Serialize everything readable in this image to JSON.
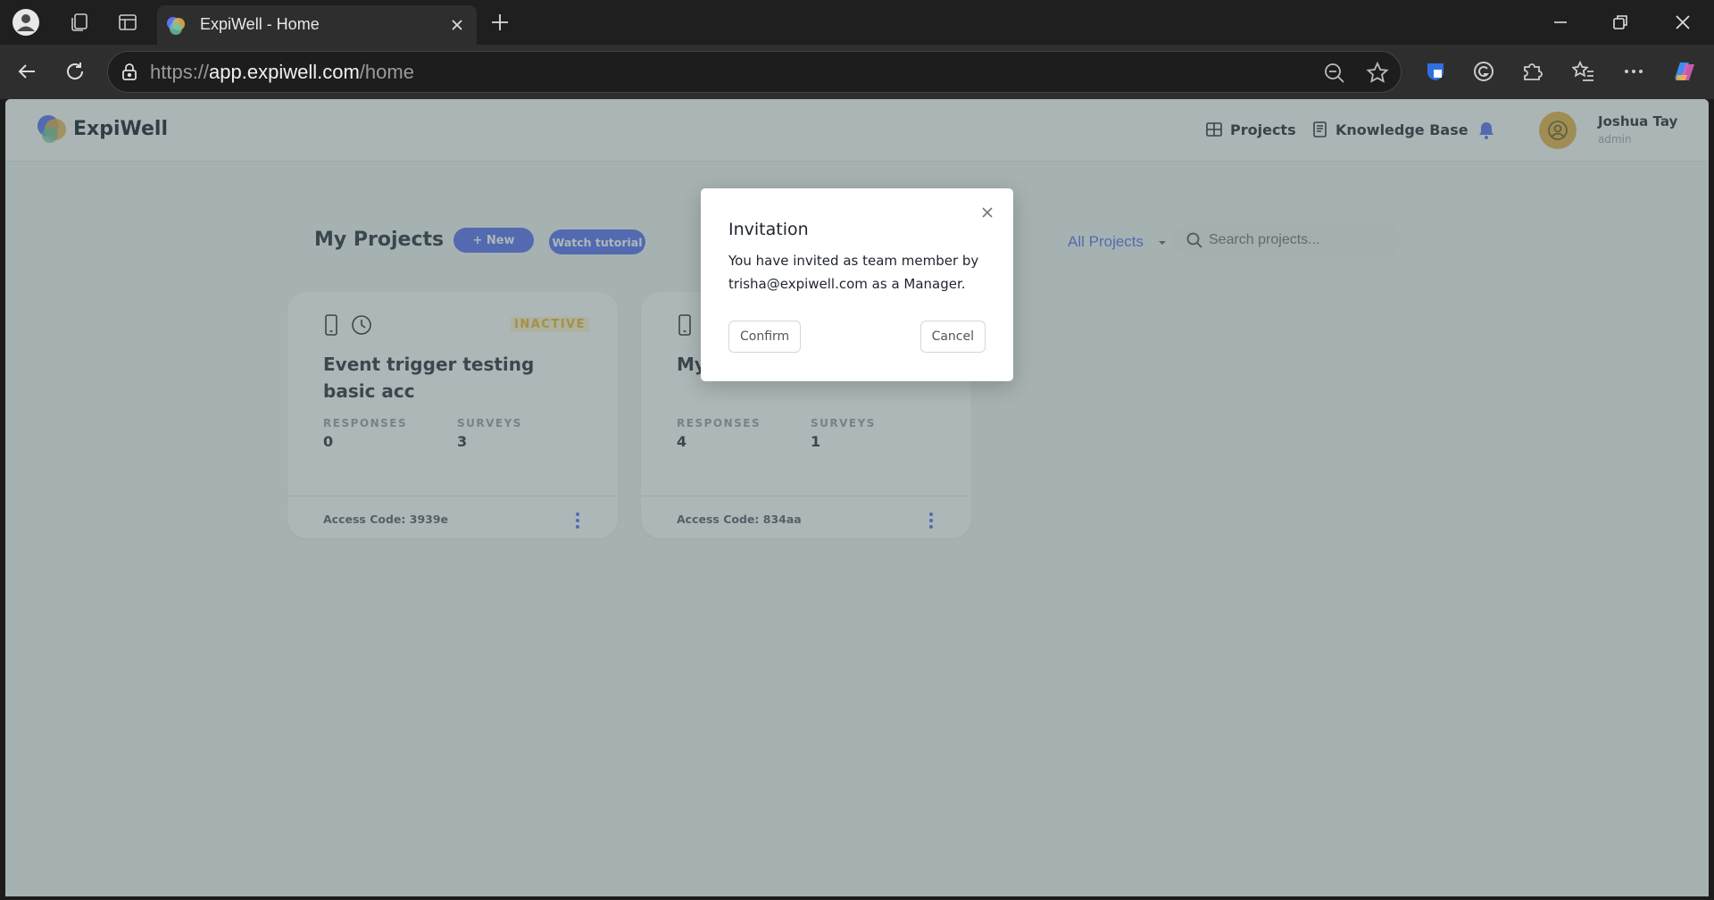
{
  "browser": {
    "tab_title": "ExpiWell - Home",
    "url_scheme": "https://",
    "url_host": "app.expiwell.com",
    "url_path": "/home"
  },
  "app": {
    "brand": "ExpiWell",
    "nav": {
      "projects": "Projects",
      "knowledge_base": "Knowledge Base"
    },
    "user": {
      "name": "Joshua Tay",
      "role": "admin"
    }
  },
  "main": {
    "title": "My Projects",
    "new_button": "+ New",
    "tutorial_button": "Watch tutorial",
    "filter_label": "All Projects",
    "search_placeholder": "Search projects..."
  },
  "projects": [
    {
      "status": "INACTIVE",
      "title": "Event trigger testing basic acc",
      "responses_label": "RESPONSES",
      "responses": "0",
      "surveys_label": "SURVEYS",
      "surveys": "3",
      "access_code": "Access Code: 3939e"
    },
    {
      "status": "",
      "title": "My",
      "responses_label": "RESPONSES",
      "responses": "4",
      "surveys_label": "SURVEYS",
      "surveys": "1",
      "access_code": "Access Code: 834aa"
    }
  ],
  "modal": {
    "title": "Invitation",
    "body": "You have invited as team member by trisha@expiwell.com as a Manager.",
    "confirm": "Confirm",
    "cancel": "Cancel"
  },
  "colors": {
    "accent": "#5b74f5",
    "inactive": "#f5b82e",
    "avatar": "#e6b24a"
  }
}
